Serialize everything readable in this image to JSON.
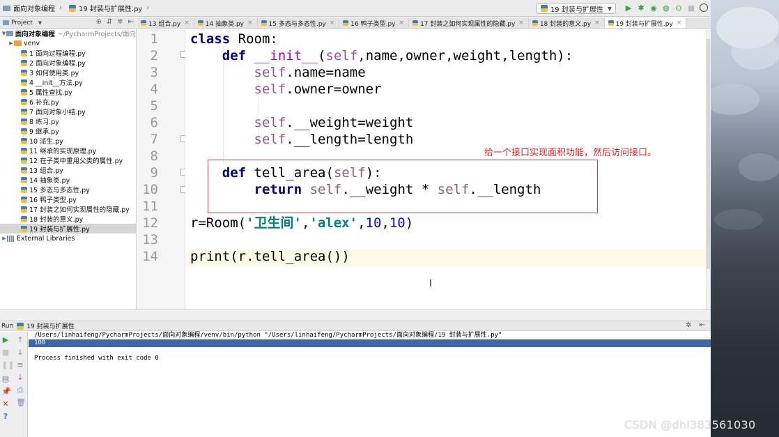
{
  "breadcrumb": {
    "project": "面向对象编程",
    "file": "19 封装与扩展性.py"
  },
  "run_config": {
    "label": "19 封装与扩展性"
  },
  "project_panel": {
    "title": "Project",
    "root": {
      "name": "面向对象编程",
      "path": "~/PycharmProjects/面向"
    },
    "folder": "venv",
    "files": [
      "1 面向过程编程.py",
      "2 面向对象编程.py",
      "3 如何使用类.py",
      "4 __init__方法.py",
      "5 属性查找.py",
      "6 补充.py",
      "7 面向对象小结.py",
      "8 练习.py",
      "9 继承.py",
      "10 派生.py",
      "11 继承的实现原理.py",
      "12 在子类中重用父类的属性.py",
      "13 组合.py",
      "14 抽象类.py",
      "15 多态与多态性.py",
      "16 鸭子类型.py",
      "17 封装之如何实现属性的隐藏.py",
      "18 封装的意义.py",
      "19 封装与扩展性.py"
    ],
    "selected_index": 18,
    "external": "External Libraries"
  },
  "tabs": [
    "13 组合.py",
    "14 抽象类.py",
    "15 多态与多态性.py",
    "16 鸭子类型.py",
    "17 封装之如何实现属性的隐藏.py",
    "18 封装的意义.py",
    "19 封装与扩展性.py"
  ],
  "active_tab": 6,
  "code": {
    "line_numbers": [
      "1",
      "2",
      "3",
      "4",
      "5",
      "6",
      "7",
      "8",
      "9",
      "10",
      "11",
      "12",
      "13",
      "14"
    ],
    "current_line": 14
  },
  "annotation": "给一个接口实现面积功能，然后访问接口。",
  "run_panel": {
    "title": "Run",
    "config": "19 封装与扩展性",
    "command": "/Users/linhaifeng/PycharmProjects/面向对象编程/venv/bin/python \"/Users/linhaifeng/PycharmProjects/面向对象编程/19 封装与扩展性.py\"",
    "output": "100",
    "exit": "Process finished with exit code 0"
  },
  "watermark": "CSDN @dhl383561030",
  "colors": {
    "keyword": "#000080",
    "self": "#94558d",
    "magic": "#b200b2",
    "string": "#008080",
    "number": "#0000ff",
    "annotation": "#e02020"
  }
}
